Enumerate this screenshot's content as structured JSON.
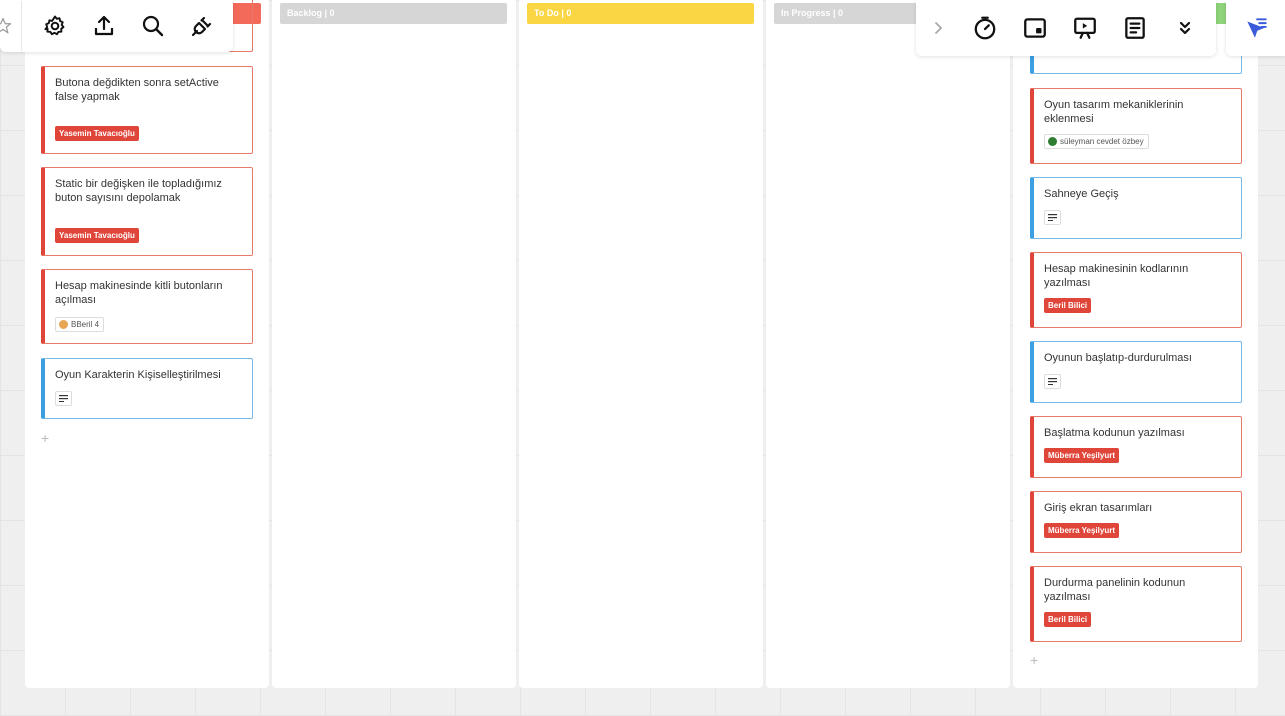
{
  "columns": [
    {
      "header": "",
      "color": "#f46a5a"
    },
    {
      "header": "Backlog  |  0",
      "color": "#d6d6d6"
    },
    {
      "header": "To Do  |  0",
      "color": "#fad644"
    },
    {
      "header": "In Progress  |  0",
      "color": "#d6d6d6"
    },
    {
      "header": "",
      "color": "#8fd37a"
    }
  ],
  "col1_cards": [
    {
      "title": "Butona değdikten sonra setActive false yapmak",
      "tag": "Yasemin Tavacıoğlu"
    },
    {
      "title": "Static bir değişken ile topladığımız buton sayısını depolamak",
      "tag": "Yasemin Tavacıoğlu"
    },
    {
      "title": "Hesap makinesinde kitli butonların açılması",
      "user": "BBeril 4"
    },
    {
      "title": "Oyun Karakterin Kişiselleştirilmesi"
    }
  ],
  "col5_cards": [
    {
      "title": "Oyun tasarım mekaniklerinin eklenmesi",
      "user": "süleyman cevdet özbey"
    },
    {
      "title": "Sahneye Geçiş"
    },
    {
      "title": "Hesap makinesinin kodlarının yazılması",
      "tag": "Beril Bilici"
    },
    {
      "title": "Oyunun başlatıp-durdurulması"
    },
    {
      "title": "Başlatma kodunun yazılması",
      "tag": "Müberra Yeşilyurt"
    },
    {
      "title": "Giriş ekran tasarımları",
      "tag": "Müberra Yeşilyurt"
    },
    {
      "title": "Durdurma panelinin kodunun yazılması",
      "tag": "Beril Bilici"
    }
  ],
  "add_symbol": "+",
  "toolbar_left": {
    "icons": [
      "star-icon",
      "settings-icon",
      "upload-icon",
      "search-icon",
      "plugin-icon"
    ]
  },
  "toolbar_right": {
    "icons": [
      "chevron-right-icon",
      "timer-icon",
      "card-icon",
      "presentation-icon",
      "document-icon",
      "double-chevron-down-icon",
      "cursor-filter-icon"
    ]
  }
}
